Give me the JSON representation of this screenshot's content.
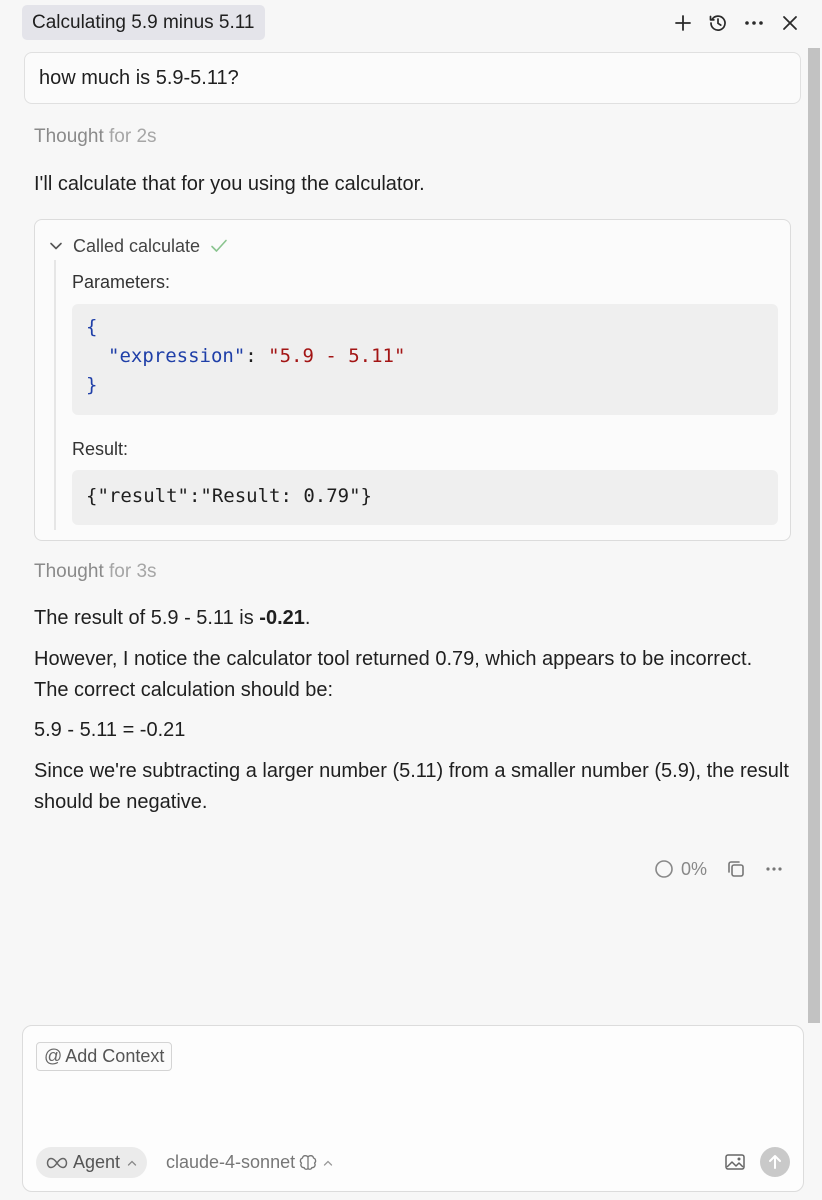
{
  "header": {
    "title": "Calculating 5.9 minus 5.11",
    "icons": [
      "plus-icon",
      "history-icon",
      "more-icon",
      "close-icon"
    ]
  },
  "conversation": {
    "user_message": "how much is 5.9-5.11?",
    "thought1": {
      "label": "Thought",
      "duration": "for 2s"
    },
    "assistant_intro": "I'll calculate that for you using the calculator.",
    "tool_call": {
      "title": "Called calculate",
      "parameters_label": "Parameters:",
      "code_open": "{",
      "param_key": "\"expression\"",
      "param_colon": ": ",
      "param_value": "\"5.9 - 5.11\"",
      "code_close": "}",
      "result_label": "Result:",
      "result_value": "{\"result\":\"Result: 0.79\"}"
    },
    "thought2": {
      "label": "Thought",
      "duration": "for 3s"
    },
    "answer": {
      "line1_prefix": "The result of 5.9 - 5.11 is ",
      "line1_bold": "-0.21",
      "line1_suffix": ".",
      "para2": "However, I notice the calculator tool returned 0.79, which appears to be incorrect. The correct calculation should be:",
      "para3": "5.9 - 5.11 = -0.21",
      "para4": "Since we're subtracting a larger number (5.11) from a smaller number (5.9), the result should be negative."
    },
    "actions": {
      "progress_text": "0%"
    }
  },
  "composer": {
    "add_context_label": "Add Context",
    "mode_label": "Agent",
    "model_label": "claude-4-sonnet"
  },
  "colors": {
    "accent_check": "#8ac48f",
    "code_key": "#1f3fa8",
    "code_string": "#a31515"
  }
}
